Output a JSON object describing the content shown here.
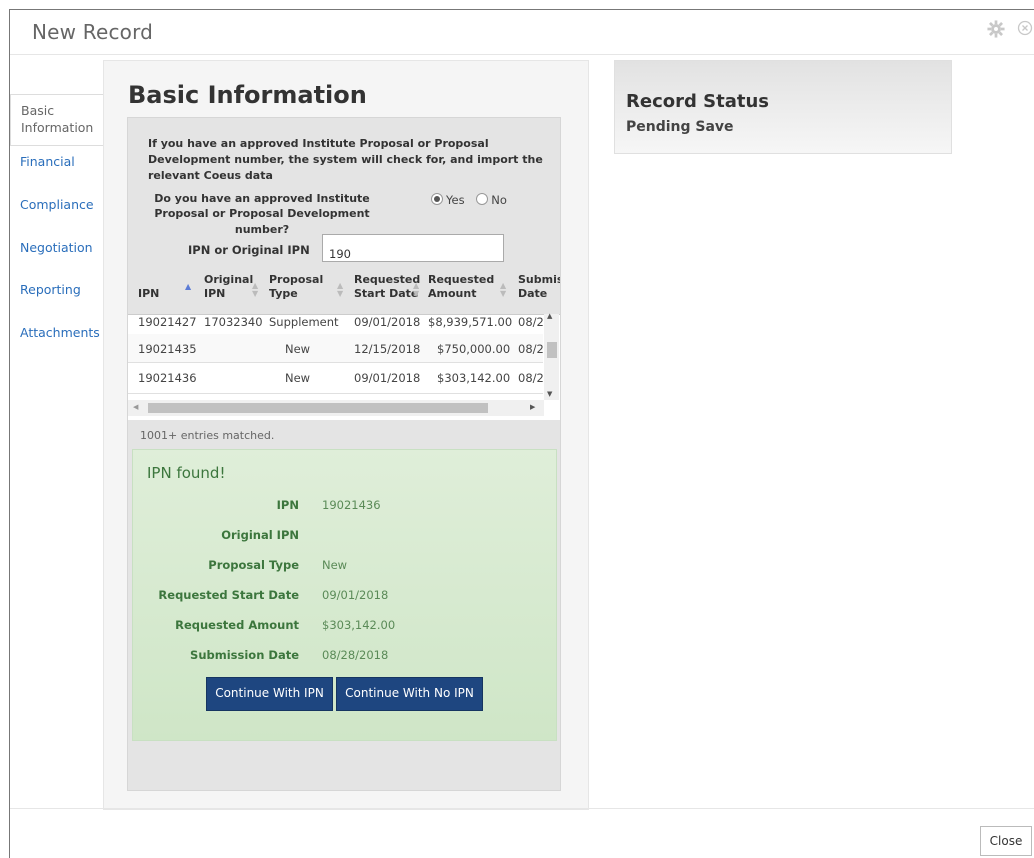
{
  "window": {
    "title": "New Record"
  },
  "sidebar": {
    "items": [
      {
        "label": "Basic Information"
      },
      {
        "label": "Financial"
      },
      {
        "label": "Compliance"
      },
      {
        "label": "Negotiation"
      },
      {
        "label": "Reporting"
      },
      {
        "label": "Attachments"
      }
    ]
  },
  "main": {
    "heading": "Basic Information",
    "intro": "If you have an approved Institute Proposal or Proposal Development number, the system will check for, and import the relevant Coeus data",
    "question": "Do you have an approved Institute Proposal or Proposal Development number?",
    "radio_yes": "Yes",
    "radio_no": "No",
    "radio_selected": "Yes",
    "ipn_label": "IPN or Original IPN",
    "ipn_value": "190",
    "table": {
      "headers": [
        {
          "line1": "",
          "line2": "IPN"
        },
        {
          "line1": "Original",
          "line2": "IPN"
        },
        {
          "line1": "Proposal",
          "line2": "Type"
        },
        {
          "line1": "Requested",
          "line2": "Start Date"
        },
        {
          "line1": "Requested",
          "line2": "Amount"
        },
        {
          "line1": "Submis",
          "line2": "Date"
        }
      ],
      "rows": [
        [
          "19021427",
          "17032340",
          "Supplement",
          "09/01/2018",
          "$8,939,571.00",
          "08/2"
        ],
        [
          "19021435",
          "",
          "New",
          "12/15/2018",
          "$750,000.00",
          "08/2"
        ],
        [
          "19021436",
          "",
          "New",
          "09/01/2018",
          "$303,142.00",
          "08/2"
        ]
      ]
    },
    "matched": "1001+ entries matched.",
    "found": {
      "heading": "IPN found!",
      "fields": [
        {
          "label": "IPN",
          "value": "19021436"
        },
        {
          "label": "Original IPN",
          "value": ""
        },
        {
          "label": "Proposal Type",
          "value": "New"
        },
        {
          "label": "Requested Start Date",
          "value": "09/01/2018"
        },
        {
          "label": "Requested Amount",
          "value": "$303,142.00"
        },
        {
          "label": "Submission Date",
          "value": "08/28/2018"
        }
      ],
      "btn_continue": "Continue With IPN",
      "btn_no_ipn": "Continue With No IPN"
    }
  },
  "status": {
    "heading": "Record Status",
    "value": "Pending Save"
  },
  "footer": {
    "close_label": "Close"
  },
  "colors": {
    "link": "#2a6ebb",
    "button": "#1e4680",
    "success_bg": "#d8ecd3",
    "success_text": "#3c763d"
  }
}
